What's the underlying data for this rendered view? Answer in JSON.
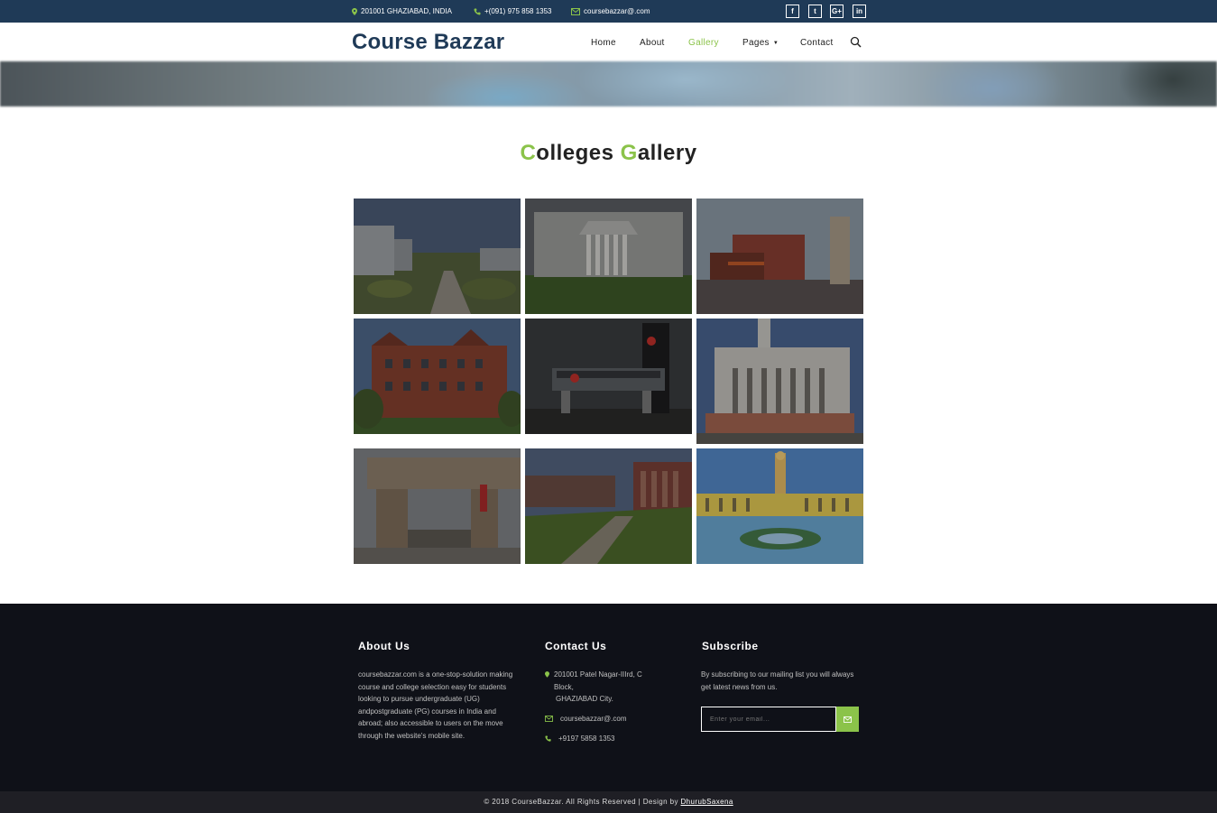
{
  "topbar": {
    "address": "201001 GHAZIABAD, INDIA",
    "phone": "+(091) 975 858 1353",
    "email": "coursebazzar@.com",
    "social": [
      "f",
      "t",
      "G+",
      "in"
    ]
  },
  "header": {
    "logo": "Course Bazzar",
    "nav": [
      "Home",
      "About",
      "Gallery",
      "Pages",
      "Contact"
    ],
    "active_nav": "Gallery"
  },
  "gallery": {
    "title_parts": [
      "C",
      "olleges ",
      "G",
      "allery"
    ],
    "images": [
      "campus-garden-photo",
      "columned-building-photo",
      "campus-gate-tower-photo",
      "red-brick-building-photo",
      "university-sign-night-photo",
      "white-columned-institute-photo",
      "university-entrance-gate-photo",
      "campus-lawn-buildings-photo",
      "clock-tower-campus-photo"
    ]
  },
  "footer": {
    "about_title": "About Us",
    "about_text": "coursebazzar.com is a one-stop-solution making course and college selection easy for students looking to pursue undergraduate (UG) andpostgraduate (PG) courses in India and abroad; also accessible to users on the move through the website's mobile site.",
    "contact_title": "Contact Us",
    "contact_address_1": "201001 Patel Nagar-IIIrd, C Block,",
    "contact_address_2": "GHAZIABAD City.",
    "contact_email": "coursebazzar@.com",
    "contact_phone": "+9197 5858 1353",
    "subscribe_title": "Subscribe",
    "subscribe_text": "By subscribing to our mailing list you will always get latest news from us.",
    "subscribe_placeholder": "Enter your email..."
  },
  "bottom": {
    "copyright": "© 2018 CourseBazzar. All Rights Reserved | Design by ",
    "designer": "DhurubSaxena"
  },
  "colors": {
    "accent": "#8bc34a",
    "navy": "#1f3a57",
    "footer_bg": "#0f1118"
  }
}
